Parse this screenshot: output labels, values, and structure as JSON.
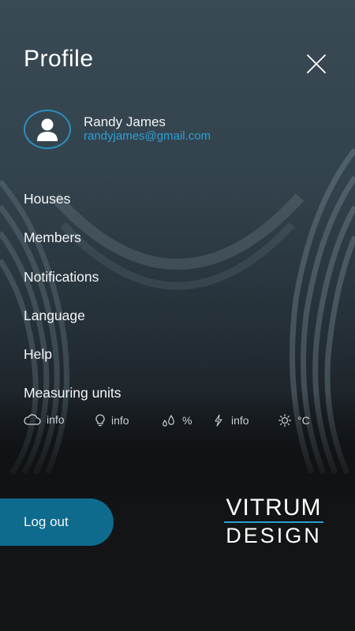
{
  "header": {
    "title": "Profile"
  },
  "user": {
    "name": "Randy James",
    "email": "randyjames@gmail.com"
  },
  "menu": {
    "items": [
      {
        "label": "Houses"
      },
      {
        "label": "Members"
      },
      {
        "label": "Notifications"
      },
      {
        "label": "Language"
      },
      {
        "label": "Help"
      },
      {
        "label": "Measuring units"
      }
    ]
  },
  "units": [
    {
      "icon": "cloud-icon",
      "label": "info"
    },
    {
      "icon": "lightbulb-icon",
      "label": "info"
    },
    {
      "icon": "droplets-icon",
      "label": "%"
    },
    {
      "icon": "lightning-icon",
      "label": "info"
    },
    {
      "icon": "sun-icon",
      "label": "°C"
    }
  ],
  "footer": {
    "logout_label": "Log out",
    "logo_top": "VITRUM",
    "logo_bottom": "DESIGN"
  },
  "colors": {
    "accent": "#2b9fd4",
    "logout_button": "#0e6b8e",
    "background": "#121416"
  }
}
